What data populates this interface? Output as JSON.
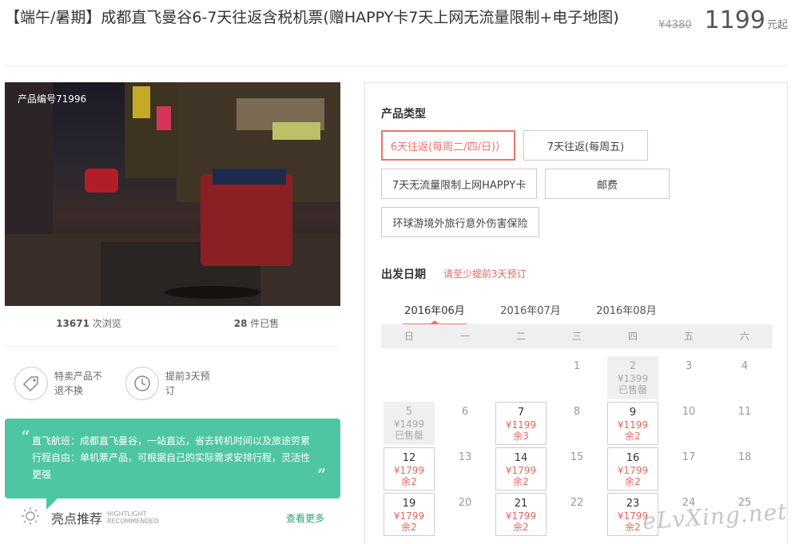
{
  "product": {
    "title": "【端午/暑期】成都直飞曼谷6-7天往返含税机票(赠HAPPY卡7天上网无流量限制+电子地图)",
    "old_price": "¥4380",
    "price": "1199",
    "price_unit": "元起"
  },
  "photo": {
    "code": "产品编号71996"
  },
  "stats": {
    "views_count": "13671",
    "views_label": "次浏览",
    "sold_count": "28",
    "sold_label": "件已售"
  },
  "features": [
    {
      "icon": "tag-icon",
      "text": "特卖产品不退不换"
    },
    {
      "icon": "clock-icon",
      "text": "提前3天预订"
    }
  ],
  "green_box": {
    "text": "直飞航班：成都直飞曼谷，一站直达，省去转机时间以及旅途劳累 行程自由：单机票产品，可根据自己的实际需求安排行程，灵活性更强"
  },
  "highlight": {
    "title": "亮点推荐",
    "en_line1": "HIGHTLIGHT",
    "en_line2": "RECOMMENDED",
    "more": "查看更多"
  },
  "panel": {
    "type_label": "产品类型",
    "options": [
      {
        "label": "6天往返(每周二/四/日)）",
        "selected": true
      },
      {
        "label": "7天往返(每周五)",
        "selected": false
      },
      {
        "label": "7天无流量限制上网HAPPY卡",
        "selected": false
      },
      {
        "label": "邮费",
        "selected": false
      },
      {
        "label": "环球游境外旅行意外伤害保险",
        "selected": false
      }
    ],
    "date_label": "出发日期",
    "date_hint": "请至少提前3天预订",
    "months": [
      "2016年06月",
      "2016年07月",
      "2016年08月"
    ],
    "active_month": 0,
    "weekdays": [
      "日",
      "一",
      "二",
      "三",
      "四",
      "五",
      "六"
    ]
  },
  "calendar_rows": [
    [
      {
        "d": ""
      },
      {
        "d": ""
      },
      {
        "d": ""
      },
      {
        "d": "1"
      },
      {
        "d": "2",
        "p": "¥1399",
        "r": "已售罄",
        "s": "sold"
      },
      {
        "d": "3"
      },
      {
        "d": "4"
      }
    ],
    [
      {
        "d": "5",
        "p": "¥1499",
        "r": "已售罄",
        "s": "sold"
      },
      {
        "d": "6"
      },
      {
        "d": "7",
        "p": "¥1199",
        "r": "余3",
        "s": "avail"
      },
      {
        "d": "8"
      },
      {
        "d": "9",
        "p": "¥1199",
        "r": "余2",
        "s": "avail"
      },
      {
        "d": "10"
      },
      {
        "d": "11"
      }
    ],
    [
      {
        "d": "12",
        "p": "¥1799",
        "r": "余2",
        "s": "avail"
      },
      {
        "d": "13"
      },
      {
        "d": "14",
        "p": "¥1799",
        "r": "余2",
        "s": "avail"
      },
      {
        "d": "15"
      },
      {
        "d": "16",
        "p": "¥1799",
        "r": "余2",
        "s": "avail"
      },
      {
        "d": "17"
      },
      {
        "d": "18"
      }
    ],
    [
      {
        "d": "19",
        "p": "¥1799",
        "r": "余2",
        "s": "avail"
      },
      {
        "d": "20"
      },
      {
        "d": "21",
        "p": "¥1799",
        "r": "余2",
        "s": "avail"
      },
      {
        "d": "22"
      },
      {
        "d": "23",
        "p": "¥1799",
        "r": "余2",
        "s": "avail"
      },
      {
        "d": "24"
      },
      {
        "d": "25"
      }
    ]
  ],
  "watermark": "eLvXing.net",
  "colors": {
    "accent": "#e8756a",
    "green": "#4fc6a3",
    "link_green": "#2e9e77"
  }
}
